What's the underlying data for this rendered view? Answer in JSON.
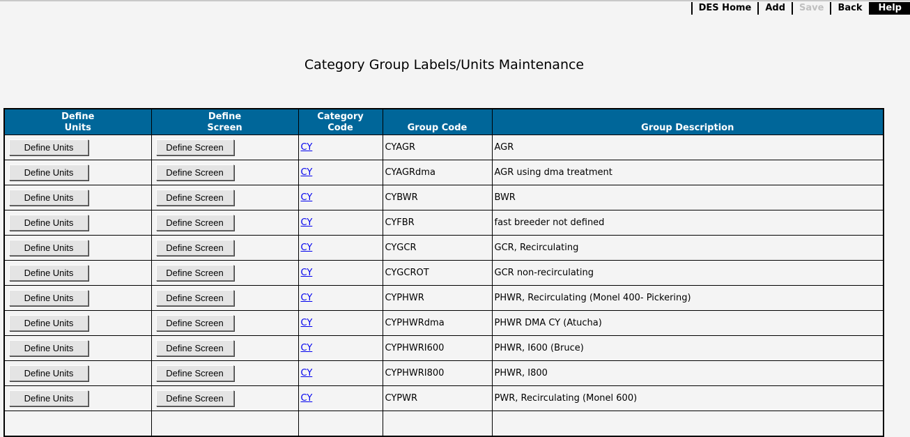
{
  "nav": {
    "home": "DES Home",
    "add": "Add",
    "save": "Save",
    "back": "Back",
    "help": "Help"
  },
  "page": {
    "title": "Category Group Labels/Units Maintenance"
  },
  "table": {
    "headers": {
      "define_units": [
        "Define",
        "Units"
      ],
      "define_screen": [
        "Define",
        "Screen"
      ],
      "category_code": [
        "Category",
        "Code"
      ],
      "group_code": "Group Code",
      "group_description": "Group Description"
    },
    "rows": [
      {
        "units_btn": "Define Units",
        "screen_btn": "Define Screen",
        "category": "CY",
        "group_code": "CYAGR",
        "description": "AGR"
      },
      {
        "units_btn": "Define Units",
        "screen_btn": "Define Screen",
        "category": "CY",
        "group_code": "CYAGRdma",
        "description": "AGR using dma treatment"
      },
      {
        "units_btn": "Define Units",
        "screen_btn": "Define Screen",
        "category": "CY",
        "group_code": "CYBWR",
        "description": "BWR"
      },
      {
        "units_btn": "Define Units",
        "screen_btn": "Define Screen",
        "category": "CY",
        "group_code": "CYFBR",
        "description": "fast breeder not defined"
      },
      {
        "units_btn": "Define Units",
        "screen_btn": "Define Screen",
        "category": "CY",
        "group_code": "CYGCR",
        "description": "GCR, Recirculating"
      },
      {
        "units_btn": "Define Units",
        "screen_btn": "Define Screen",
        "category": "CY",
        "group_code": "CYGCROT",
        "description": "GCR non-recirculating"
      },
      {
        "units_btn": "Define Units",
        "screen_btn": "Define Screen",
        "category": "CY",
        "group_code": "CYPHWR",
        "description": "PHWR, Recirculating (Monel 400- Pickering)"
      },
      {
        "units_btn": "Define Units",
        "screen_btn": "Define Screen",
        "category": "CY",
        "group_code": "CYPHWRdma",
        "description": "PHWR DMA CY (Atucha)"
      },
      {
        "units_btn": "Define Units",
        "screen_btn": "Define Screen",
        "category": "CY",
        "group_code": "CYPHWRI600",
        "description": "PHWR, I600 (Bruce)"
      },
      {
        "units_btn": "Define Units",
        "screen_btn": "Define Screen",
        "category": "CY",
        "group_code": "CYPHWRI800",
        "description": "PHWR, I800"
      },
      {
        "units_btn": "Define Units",
        "screen_btn": "Define Screen",
        "category": "CY",
        "group_code": "CYPWR",
        "description": "PWR, Recirculating (Monel 600)"
      },
      {
        "units_btn": "",
        "screen_btn": "",
        "category": "",
        "group_code": "",
        "description": ""
      }
    ]
  },
  "colors": {
    "header_bg": "#006699",
    "page_bg": "#f4f4f4",
    "link": "#0000ee"
  }
}
